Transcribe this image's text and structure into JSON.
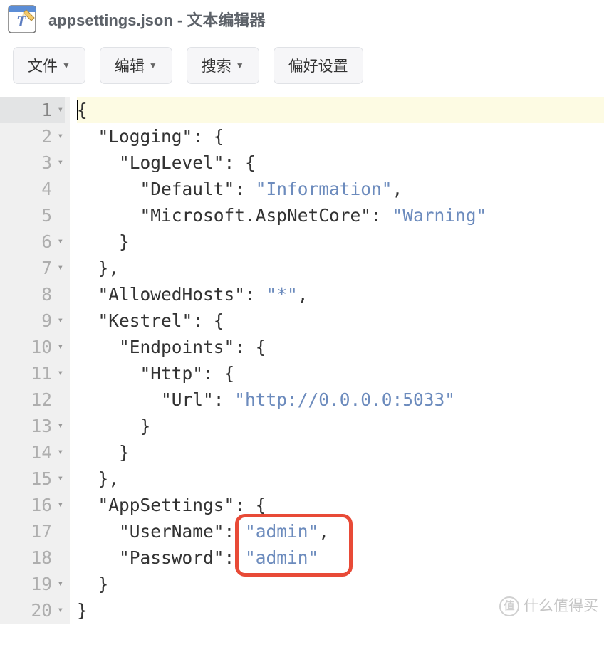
{
  "title": "appsettings.json - 文本编辑器",
  "toolbar": {
    "file": "文件",
    "edit": "编辑",
    "search": "搜索",
    "prefs": "偏好设置"
  },
  "gutter": {
    "lines": [
      {
        "n": "1",
        "fold": true
      },
      {
        "n": "2",
        "fold": true
      },
      {
        "n": "3",
        "fold": true
      },
      {
        "n": "4",
        "fold": false
      },
      {
        "n": "5",
        "fold": false
      },
      {
        "n": "6",
        "fold": true
      },
      {
        "n": "7",
        "fold": true
      },
      {
        "n": "8",
        "fold": false
      },
      {
        "n": "9",
        "fold": true
      },
      {
        "n": "10",
        "fold": true
      },
      {
        "n": "11",
        "fold": true
      },
      {
        "n": "12",
        "fold": false
      },
      {
        "n": "13",
        "fold": true
      },
      {
        "n": "14",
        "fold": true
      },
      {
        "n": "15",
        "fold": true
      },
      {
        "n": "16",
        "fold": true
      },
      {
        "n": "17",
        "fold": false
      },
      {
        "n": "18",
        "fold": false
      },
      {
        "n": "19",
        "fold": true
      },
      {
        "n": "20",
        "fold": true
      }
    ]
  },
  "code": {
    "l1": {
      "a": "{"
    },
    "l2": {
      "a": "  \"Logging\"",
      "b": ": {"
    },
    "l3": {
      "a": "    \"LogLevel\"",
      "b": ": {"
    },
    "l4": {
      "a": "      \"Default\"",
      "b": ": ",
      "c": "\"Information\"",
      "d": ","
    },
    "l5": {
      "a": "      \"Microsoft.AspNetCore\"",
      "b": ": ",
      "c": "\"Warning\""
    },
    "l6": {
      "a": "    }"
    },
    "l7": {
      "a": "  },"
    },
    "l8": {
      "a": "  \"AllowedHosts\"",
      "b": ": ",
      "c": "\"*\"",
      "d": ","
    },
    "l9": {
      "a": "  \"Kestrel\"",
      "b": ": {"
    },
    "l10": {
      "a": "    \"Endpoints\"",
      "b": ": {"
    },
    "l11": {
      "a": "      \"Http\"",
      "b": ": {"
    },
    "l12": {
      "a": "        \"Url\"",
      "b": ": ",
      "c": "\"http://0.0.0.0:5033\""
    },
    "l13": {
      "a": "      }"
    },
    "l14": {
      "a": "    }"
    },
    "l15": {
      "a": "  },"
    },
    "l16": {
      "a": "  \"AppSettings\"",
      "b": ": {"
    },
    "l17": {
      "a": "    \"UserName\"",
      "b": ": ",
      "c": "\"admin\"",
      "d": ","
    },
    "l18": {
      "a": "    \"Password\"",
      "b": ": ",
      "c": "\"admin\""
    },
    "l19": {
      "a": "  }"
    },
    "l20": {
      "a": "}"
    }
  },
  "watermark": {
    "icon": "值",
    "text": "什么值得买"
  }
}
